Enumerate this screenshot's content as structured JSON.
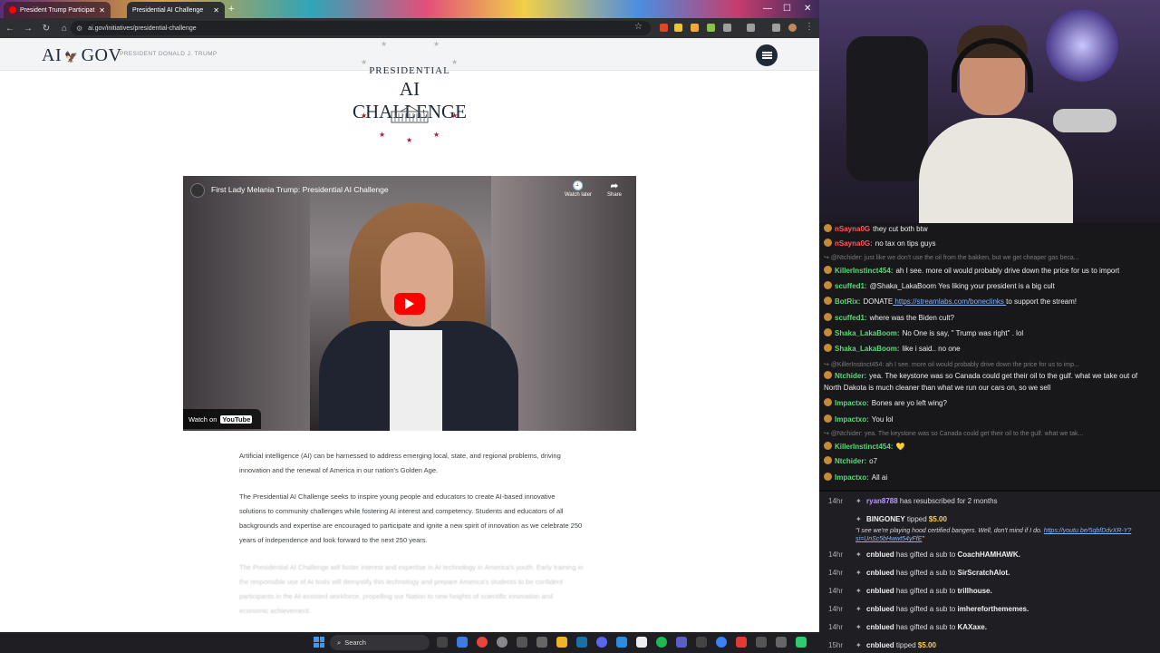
{
  "browser": {
    "tabs": [
      {
        "title": "President Trump Participat",
        "active": false
      },
      {
        "title": "Presidential AI Challenge",
        "active": true
      }
    ],
    "url": "ai.gov/initiatives/presidential-challenge"
  },
  "site": {
    "logo_left": "AI",
    "logo_right": "GOV",
    "eagle_icon": "eagle-emblem",
    "header_subtitle": "PRESIDENT DONALD J. TRUMP",
    "emblem_line1": "PRESIDENTIAL",
    "emblem_line2": "AI CHALLENGE",
    "accent_color": "#b01e2f"
  },
  "video": {
    "title": "First Lady Melania Trump: Presidential AI Challenge",
    "watch_later": "Watch later",
    "share": "Share",
    "watch_on": "Watch on",
    "youtube": "YouTube"
  },
  "paragraphs": [
    "Artificial intelligence (AI) can be harnessed to address emerging local, state, and regional problems, driving innovation and the renewal of America in our nation's Golden Age.",
    "The Presidential AI Challenge seeks to inspire young people and educators to create AI-based innovative solutions to community challenges while fostering AI interest and competency. Students and educators of all backgrounds and expertise are encouraged to participate and ignite a new spirit of innovation as we celebrate 250 years of independence and look forward to the next 250 years.",
    "The Presidential AI Challenge will foster interest and expertise in AI technology in America's youth. Early training in the responsible use of AI tools will demystify this technology and prepare America's students to be confident participants in the AI-assisted workforce, propelling our Nation to new heights of scientific innovation and economic achievement."
  ],
  "chat": [
    {
      "user": "nSayna0G",
      "color": "#ff5a5a",
      "text": "they cut both btw",
      "partial": true
    },
    {
      "user": "nSayna0G:",
      "color": "#ff5a5a",
      "text": "no tax on tips guys"
    },
    {
      "reply": "@Ntchider: just like we don't use the oil from the bakken, but we get cheaper gas beca..."
    },
    {
      "user": "KillerInstinct454:",
      "color": "#5fd77a",
      "text": "ah I see. more oil would probably drive down the price for us to import"
    },
    {
      "user": "scuffed1:",
      "color": "#5fd77a",
      "text": "@Shaka_LakaBoom Yes liking your president is a big cult"
    },
    {
      "user": "BotRix:",
      "color": "#5fd77a",
      "text": "DONATE",
      "link": "https://streamlabs.com/boneclinks",
      "after": "to support the stream!"
    },
    {
      "user": "scuffed1:",
      "color": "#5fd77a",
      "text": "where was the Biden cult?"
    },
    {
      "user": "Shaka_LakaBoom:",
      "color": "#5fd77a",
      "text": "No One is say, \" Trump was right\" . lol"
    },
    {
      "user": "Shaka_LakaBoom:",
      "color": "#5fd77a",
      "text": "like i said.. no one"
    },
    {
      "reply": "@KillerInstinct454: ah I see. more oil would probably drive down the price for us to imp..."
    },
    {
      "user": "Ntchider:",
      "color": "#5fd77a",
      "text": "yea. The keystone was so Canada could get their oil to the gulf. what we take out of North Dakota is much cleaner than what we run our cars on, so we sell"
    },
    {
      "user": "Impactxo:",
      "color": "#5fd77a",
      "text": "Bones are yo left wing?"
    },
    {
      "user": "Impactxo:",
      "color": "#5fd77a",
      "text": "You lol"
    },
    {
      "reply": "@Ntchider: yea. The keystone was so Canada could get their oil to the gulf. what we tak..."
    },
    {
      "user": "KillerInstinct454:",
      "color": "#5fd77a",
      "text": "💛"
    },
    {
      "user": "Ntchider:",
      "color": "#5fd77a",
      "text": "o7"
    },
    {
      "user": "Impactxo:",
      "color": "#5fd77a",
      "text": "All ai"
    }
  ],
  "events": [
    {
      "time": "14hr",
      "name": "ryan8788",
      "text": "has resubscribed for 2 months"
    },
    {
      "time": "",
      "name": "BINGONEY",
      "text": "tipped",
      "amount": "$5.00",
      "message": "\"I see we're playing hood certified bangers. Well, don't mind if I do.",
      "link": "https://youtu.be/5qbfDdvXR-Y?si=UnSc5bHwwt54yFfE",
      "end": "\""
    },
    {
      "time": "14hr",
      "name": "cnblued",
      "text": "has gifted a sub to",
      "target": "CoachHAMHAWK."
    },
    {
      "time": "14hr",
      "name": "cnblued",
      "text": "has gifted a sub to",
      "target": "SirScratchAlot."
    },
    {
      "time": "14hr",
      "name": "cnblued",
      "text": "has gifted a sub to",
      "target": "trillhouse."
    },
    {
      "time": "14hr",
      "name": "cnblued",
      "text": "has gifted a sub to",
      "target": "imhereforthememes."
    },
    {
      "time": "14hr",
      "name": "cnblued",
      "text": "has gifted a sub to",
      "target": "KAXaxe."
    },
    {
      "time": "15hr",
      "name": "cnblued",
      "text": "tipped",
      "amount": "$5.00"
    }
  ],
  "taskbar": {
    "search": "Search"
  }
}
